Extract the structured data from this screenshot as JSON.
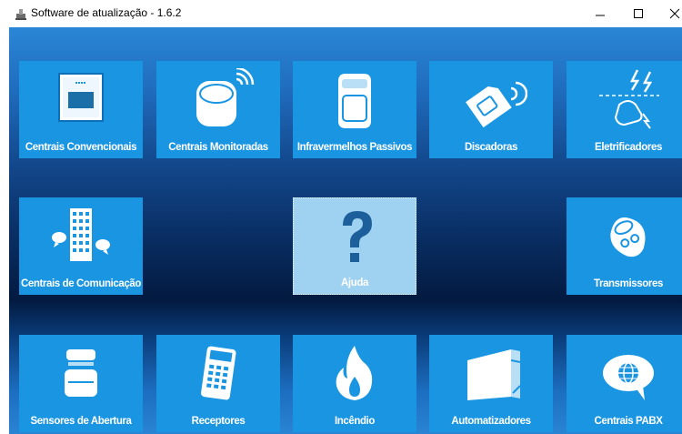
{
  "window": {
    "title": "Software de atualização - 1.6.2",
    "minimize_label": "minimize",
    "maximize_label": "maximize",
    "close_label": "close"
  },
  "tiles": [
    {
      "label": "Centrais Convencionais",
      "icon": "control-panel-icon"
    },
    {
      "label": "Centrais Monitoradas",
      "icon": "monitored-central-icon"
    },
    {
      "label": "Infravermelhos Passivos",
      "icon": "pir-sensor-icon"
    },
    {
      "label": "Discadoras",
      "icon": "sim-dialer-icon"
    },
    {
      "label": "Eletrificadores",
      "icon": "electric-fence-icon"
    },
    {
      "label": "Centrais de Comunicação",
      "icon": "building-communication-icon"
    },
    {
      "label": "Ajuda",
      "icon": "question-mark-icon"
    },
    {
      "label": "Transmissores",
      "icon": "transmitter-icon"
    },
    {
      "label": "Sensores de Abertura",
      "icon": "magnetic-sensor-icon"
    },
    {
      "label": "Receptores",
      "icon": "keypad-receiver-icon"
    },
    {
      "label": "Incêndio",
      "icon": "fire-icon"
    },
    {
      "label": "Automatizadores",
      "icon": "gate-icon"
    },
    {
      "label": "Centrais PABX",
      "icon": "pabx-icon"
    }
  ],
  "colors": {
    "tile": "#1a95e2",
    "tile_selected": "#9fd1f1",
    "text": "#ffffff"
  }
}
